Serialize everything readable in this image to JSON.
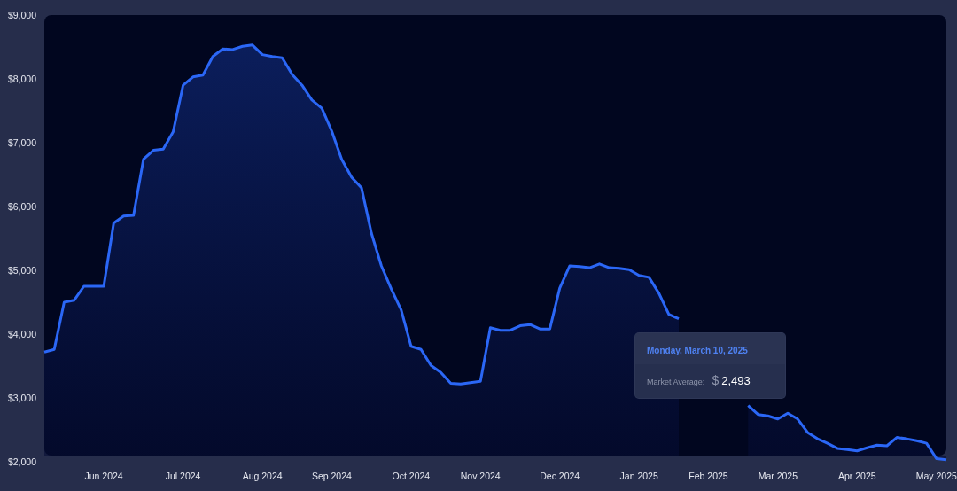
{
  "chart": {
    "chart_data": {
      "type": "area",
      "ylim": [
        2000,
        9000
      ],
      "yticks": [
        {
          "value": 2000,
          "label": "$2,000"
        },
        {
          "value": 3000,
          "label": "$3,000"
        },
        {
          "value": 4000,
          "label": "$4,000"
        },
        {
          "value": 5000,
          "label": "$5,000"
        },
        {
          "value": 6000,
          "label": "$6,000"
        },
        {
          "value": 7000,
          "label": "$7,000"
        },
        {
          "value": 8000,
          "label": "$8,000"
        },
        {
          "value": 9000,
          "label": "$9,000"
        }
      ],
      "categories": [
        null,
        null,
        null,
        null,
        null,
        null,
        "Jun 2024",
        null,
        null,
        null,
        null,
        null,
        null,
        null,
        "Jul 2024",
        null,
        null,
        null,
        null,
        null,
        null,
        null,
        "Aug 2024",
        null,
        null,
        null,
        null,
        null,
        null,
        "Sep 2024",
        null,
        null,
        null,
        null,
        null,
        null,
        null,
        "Oct 2024",
        null,
        null,
        null,
        null,
        null,
        null,
        "Nov 2024",
        null,
        null,
        null,
        null,
        null,
        null,
        null,
        "Dec 2024",
        null,
        null,
        null,
        null,
        null,
        null,
        null,
        "Jan 2025",
        null,
        null,
        null,
        null,
        null,
        null,
        "Feb 2025",
        null,
        null,
        null,
        null,
        null,
        null,
        "Mar 2025",
        null,
        null,
        null,
        null,
        null,
        null,
        null,
        "Apr 2025",
        null,
        null,
        null,
        null,
        null,
        null,
        null,
        "May 2025",
        null
      ],
      "series": [
        {
          "color": "#2b67f6",
          "values": [
            3720,
            3760,
            4500,
            4530,
            4750,
            4750,
            4750,
            5740,
            5850,
            5860,
            6740,
            6880,
            6900,
            7170,
            7900,
            8030,
            8060,
            8350,
            8470,
            8460,
            8510,
            8530,
            8380,
            8350,
            8330,
            8070,
            7900,
            7670,
            7540,
            7180,
            6740,
            6460,
            6290,
            5580,
            5070,
            4710,
            4380,
            3810,
            3760,
            3510,
            3400,
            3230,
            3220,
            3240,
            3260,
            4100,
            4060,
            4060,
            4130,
            4150,
            4080,
            4080,
            4720,
            5070,
            5060,
            5040,
            5100,
            5040,
            5030,
            5010,
            4920,
            4890,
            4640,
            4310,
            4240,
            null,
            null,
            null,
            null,
            null,
            null,
            2880,
            2740,
            2720,
            2670,
            2760,
            2670,
            2460,
            2360,
            2290,
            2210,
            2190,
            2170,
            2220,
            2260,
            2250,
            2380,
            2360,
            2330,
            2290,
            2050,
            2030
          ]
        }
      ]
    }
  },
  "tooltip": {
    "date": "Monday, March 10, 2025",
    "label": "Market Average:",
    "currency": "$",
    "value": "2,493"
  }
}
